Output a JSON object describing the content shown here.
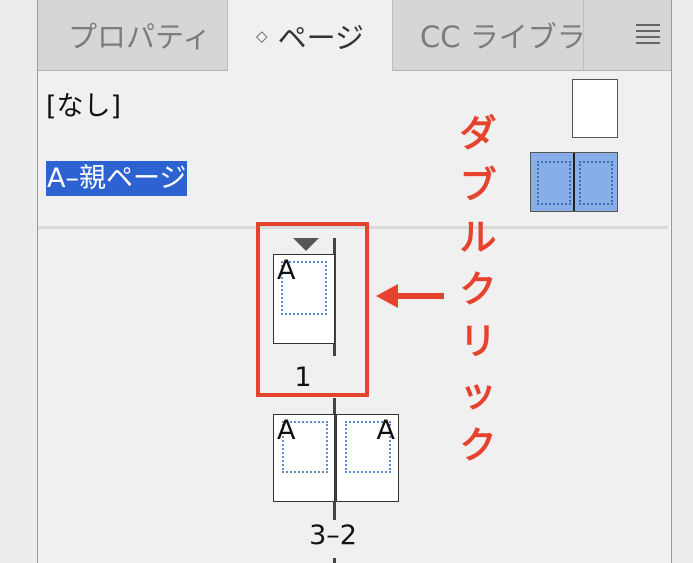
{
  "tabs": [
    {
      "label": "プロパティ",
      "active": false
    },
    {
      "label": "ページ",
      "active": true
    },
    {
      "label": "CC ライブラ",
      "active": false
    }
  ],
  "parents": {
    "none_label": "[なし]",
    "a_parent_label": "A–親ページ",
    "selected": "A–親ページ"
  },
  "pages": {
    "page1": {
      "letter": "A",
      "label": "1"
    },
    "spread": {
      "left_letter": "A",
      "right_letter": "A",
      "label": "3–2"
    }
  },
  "annotation": {
    "chars": [
      "ダ",
      "ブ",
      "ル",
      "ク",
      "リ",
      "ッ",
      "ク"
    ]
  },
  "colors": {
    "accent_red": "#e6432f",
    "selection_blue": "#2d63d1",
    "parent_thumb_fill": "#87aee6",
    "margin_guide": "#5a8fd0"
  },
  "icons": {
    "tab_sort": "up-down-chevron-icon",
    "panel_menu": "hamburger-menu-icon",
    "current_page": "current-page-triangle-icon",
    "arrow": "left-arrow-icon"
  }
}
